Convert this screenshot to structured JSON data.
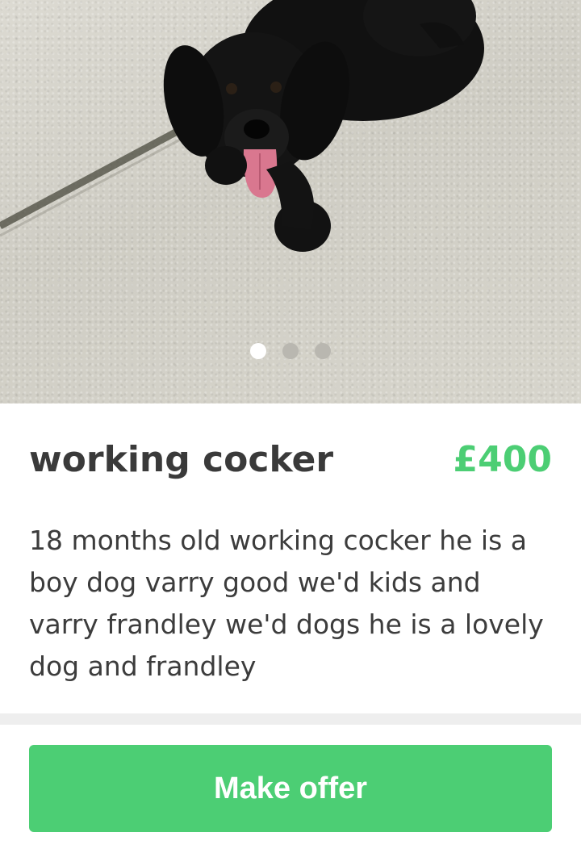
{
  "photo": {
    "icon": "dog-photo",
    "carousel": {
      "total": 3,
      "active_index": 0
    }
  },
  "listing": {
    "title": "working cocker",
    "price": "£400",
    "description": "18 months old working cocker he is a boy dog varry good we'd kids and varry frandley we'd dogs he is a lovely dog and frandley"
  },
  "actions": {
    "make_offer_label": "Make offer"
  },
  "colors": {
    "accent": "#4cce74",
    "title_text": "#3a3a3a",
    "divider": "#eeeeee"
  }
}
